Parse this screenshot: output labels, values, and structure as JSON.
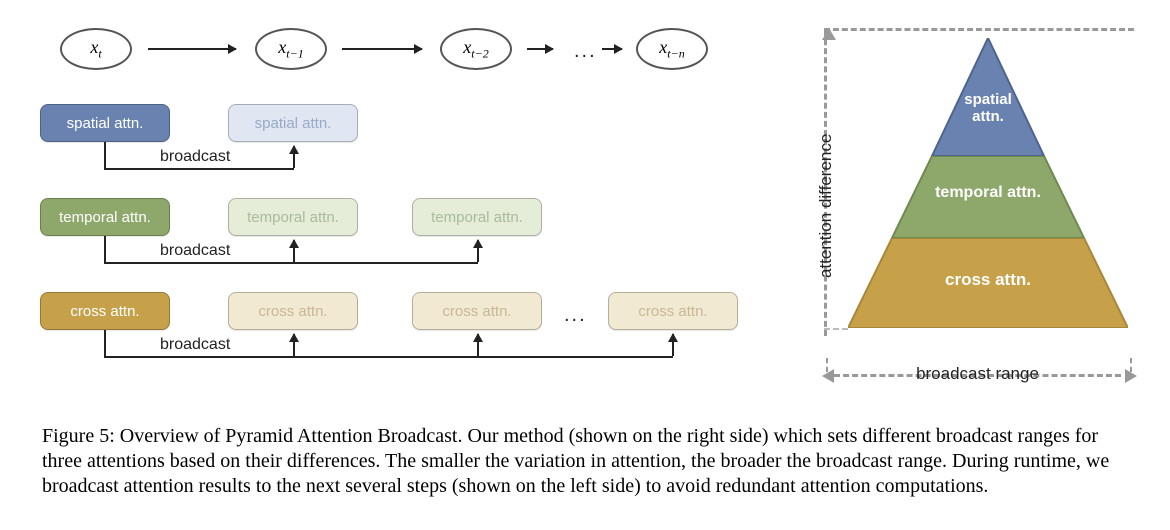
{
  "colors": {
    "spatial": "#6a82b0",
    "temporal": "#8ea86b",
    "cross": "#c7a14a",
    "spatial_outline": "#4e648f",
    "temporal_outline": "#6f8a4e",
    "cross_outline": "#a98638"
  },
  "left": {
    "columns": {
      "c0": {
        "x_sub": "t"
      },
      "c1": {
        "x_sub": "t−1"
      },
      "c2": {
        "x_sub": "t−2"
      },
      "cn": {
        "x_sub": "t−n"
      },
      "ellipsis": "..."
    },
    "attn": {
      "spatial": "spatial attn.",
      "temporal": "temporal attn.",
      "cross": "cross attn."
    },
    "broadcast_label": "broadcast"
  },
  "right": {
    "y_axis": "attention difference",
    "x_axis": "broadcast range",
    "layers": {
      "spatial": "spatial attn.",
      "temporal": "temporal attn.",
      "cross": "cross attn."
    }
  },
  "caption": "Figure 5: Overview of Pyramid Attention Broadcast. Our method (shown on the right side) which sets different broadcast ranges for three attentions based on their differences. The smaller the variation in attention, the broader the broadcast range. During runtime, we broadcast attention results to the next several steps (shown on the left side) to avoid redundant attention computations.",
  "chart_data": {
    "type": "diagram",
    "left_diagram": {
      "timesteps": [
        "x_t",
        "x_{t-1}",
        "x_{t-2}",
        "...",
        "x_{t-n}"
      ],
      "attention_broadcast": [
        {
          "type": "spatial",
          "source_step": "x_t",
          "broadcast_to": [
            "x_{t-1}"
          ]
        },
        {
          "type": "temporal",
          "source_step": "x_t",
          "broadcast_to": [
            "x_{t-1}",
            "x_{t-2}"
          ]
        },
        {
          "type": "cross",
          "source_step": "x_t",
          "broadcast_to": [
            "x_{t-1}",
            "x_{t-2}",
            "...",
            "x_{t-n}"
          ]
        }
      ],
      "note": "arrows point from later timestep to earlier along the top; broadcast arrows point upward into ghost boxes"
    },
    "right_pyramid": {
      "x_axis": "broadcast range",
      "y_axis": "attention difference",
      "layers_top_to_bottom": [
        {
          "name": "spatial attn.",
          "color": "#6a82b0",
          "relative_range": 1,
          "relative_difference": 3
        },
        {
          "name": "temporal attn.",
          "color": "#8ea86b",
          "relative_range": 2,
          "relative_difference": 2
        },
        {
          "name": "cross attn.",
          "color": "#c7a14a",
          "relative_range": 3,
          "relative_difference": 1
        }
      ],
      "interpretation": "smaller attention difference -> broader broadcast range (wider pyramid base)"
    }
  }
}
